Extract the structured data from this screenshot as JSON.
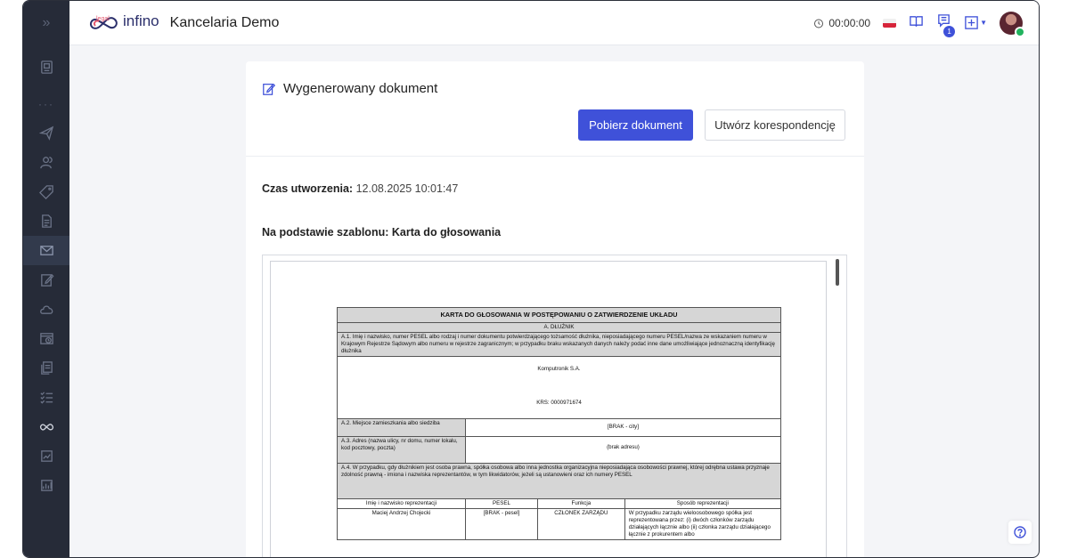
{
  "header": {
    "logo_text": "infino",
    "logo_sub": "legal",
    "title": "Kancelaria Demo",
    "timer": "00:00:00",
    "notification_count": "1"
  },
  "sidebar": {
    "toggle": "»",
    "dots": "···"
  },
  "card": {
    "title": "Wygenerowany dokument",
    "download_label": "Pobierz dokument",
    "correspondence_label": "Utwórz korespondencję",
    "created_label": "Czas utworzenia:",
    "created_value": "12.08.2025 10:01:47",
    "template_label": "Na podstawie szablonu:",
    "template_value": "Karta do głosowania"
  },
  "doc": {
    "title": "KARTA DO GŁOSOWANIA W POSTĘPOWANIU O ZATWIERDZENIE UKŁADU",
    "section_a": "A. DŁUŻNIK",
    "a1_label": "A.1. Imię i nazwisko, numer PESEL albo rodzaj i numer dokumentu potwierdzającego tożsamość dłużnika, nieposiadającego numeru PESEL/nazwa ze wskazaniem numeru w Krajowym Rejestrze Sądowym albo numeru w rejestrze zagranicznym; w przypadku braku wskazanych danych należy podać inne dane umożliwiające jednoznaczną identyfikację dłużnika",
    "a1_name": "Komputronik S.A.",
    "a1_krs": "KRS: 0000971674",
    "a2_label": "A.2. Miejsce zamieszkania albo siedziba",
    "a2_value": "[BRAK - city]",
    "a3_label": "A.3. Adres (nazwa ulicy, nr domu, numer lokalu, kod pocztowy, poczta)",
    "a3_value": "(brak adresu)",
    "a4_label": "A.4. W przypadku, gdy dłużnikiem jest osoba prawna, spółka osobowa albo inna jednostka organizacyjna nieposiadająca osobowości prawnej, której odrębna ustawa przyznaje zdolność prawną - imiona i nazwiska reprezentantów, w tym likwidatorów, jeżeli są ustanowieni oraz ich numery PESEL",
    "columns": [
      "Imię i nazwisko reprezentacji",
      "PESEL",
      "Funkcja",
      "Sposób reprezentacji"
    ],
    "row": {
      "name": "Maciej Andrzej Chojecki",
      "pesel": "[BRAK - pesel]",
      "function": "CZŁONEK ZARZĄDU",
      "method": "W przypadku zarządu wieloosobowego spółka jest reprezentowana przez: (i) dwóch członków zarządu działających łącznie albo (ii) członka zarządu działającego łącznie z prokurentem albo"
    }
  }
}
